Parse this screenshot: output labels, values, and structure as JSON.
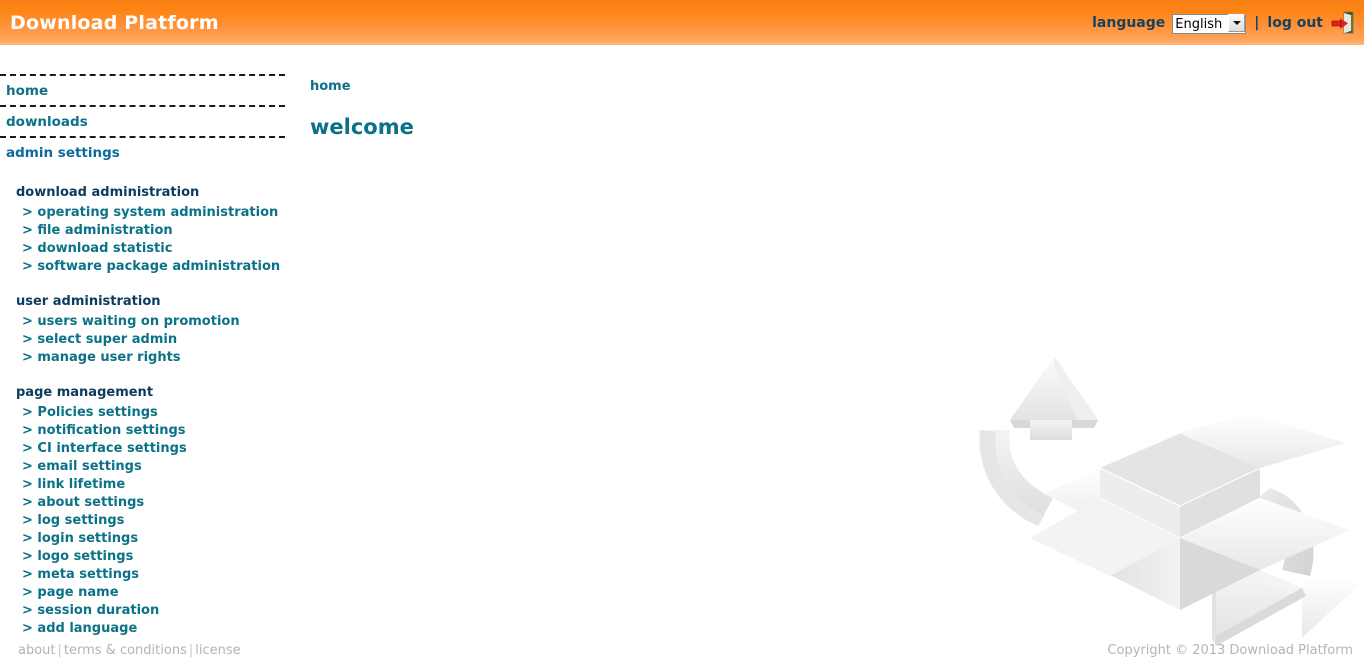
{
  "header": {
    "title": "Download Platform",
    "language_label": "language",
    "language_selected": "English",
    "language_options": [
      "English"
    ],
    "separator": "|",
    "logout_label": "log out",
    "logout_icon": "logout-door-arrow-icon",
    "gradient_top": "#f77f15",
    "gradient_bottom": "#ffb57c",
    "title_color": "#ffffff",
    "label_color": "#17415e"
  },
  "sidebar": {
    "top_items": [
      {
        "label": "home",
        "color": "#0b7287"
      },
      {
        "label": "downloads",
        "color": "#0b7287"
      },
      {
        "label": "admin settings",
        "color": "#0d6a9e"
      }
    ],
    "groups": [
      {
        "title": "download administration",
        "items": [
          "> operating system administration",
          "> file administration",
          "> download statistic",
          "> software package administration"
        ]
      },
      {
        "title": "user administration",
        "items": [
          "> users waiting on promotion",
          "> select super admin",
          "> manage user rights"
        ]
      },
      {
        "title": "page management",
        "items": [
          "> Policies settings",
          "> notification settings",
          "> CI interface settings",
          "> email settings",
          "> link lifetime",
          "> about settings",
          "> log settings",
          "> login settings",
          "> logo settings",
          "> meta settings",
          "> page name",
          "> session duration",
          "> add language"
        ]
      }
    ],
    "link_color": "#0b7287",
    "group_title_color": "#0d3b5e"
  },
  "main": {
    "breadcrumb": "home",
    "page_title": "welcome",
    "title_color": "#0b7287",
    "watermark_icon": "open-box-with-circular-arrows-icon"
  },
  "footer": {
    "links": [
      "about",
      "terms & conditions",
      "license"
    ],
    "separator": "|",
    "copyright": "Copyright © 2013 Download Platform",
    "text_color": "#b3b3b3"
  }
}
